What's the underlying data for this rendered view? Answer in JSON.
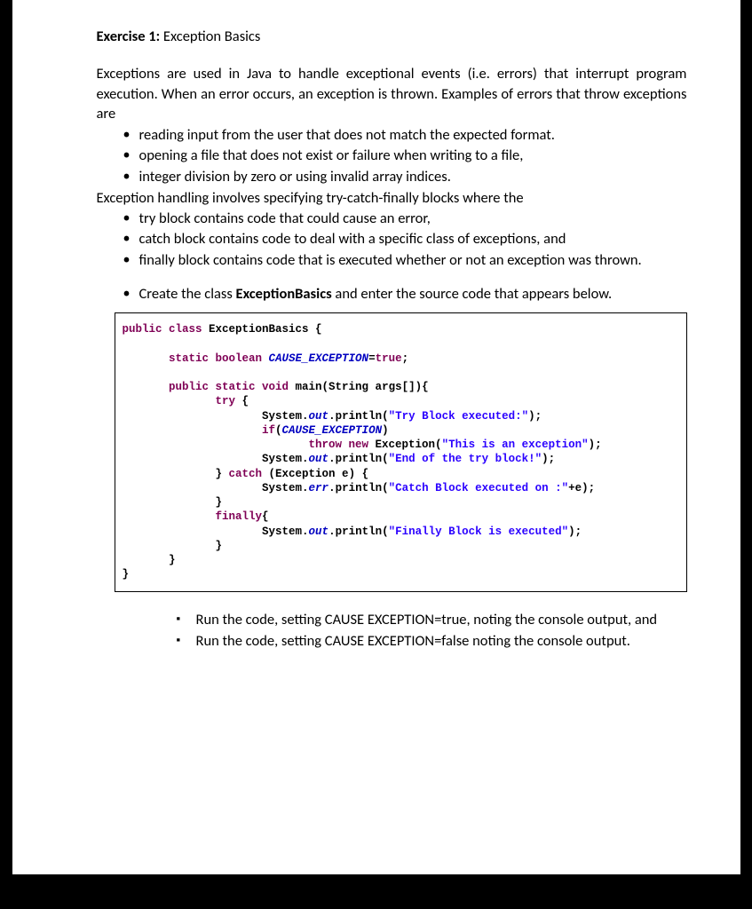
{
  "heading": {
    "label": "Exercise 1:",
    "title": " Exception Basics"
  },
  "intro": "Exceptions are used in Java to handle exceptional events (i.e. errors) that interrupt program execution. When an error occurs, an exception is thrown. Examples of errors that throw exceptions are",
  "examples": [
    "reading input from the user that does not match the expected format.",
    "opening a file that does not exist or failure when writing to a file,",
    "integer division by zero or using invalid array indices."
  ],
  "handling_intro": "Exception handling involves specifying try-catch-finally blocks where the",
  "handling_points": [
    "try block contains code that could cause an error,",
    "catch block contains code to deal with a specific class of exceptions, and",
    "finally block contains code that is executed whether or not an exception was thrown."
  ],
  "task_prefix": "Create the class ",
  "task_classname": "ExceptionBasics",
  "task_suffix": " and enter the source code that appears below.",
  "code": {
    "l1a": "public class ",
    "l1b": "ExceptionBasics {",
    "l2a": "       static boolean ",
    "l2b": "CAUSE_EXCEPTION",
    "l2c": "=",
    "l2d": "true",
    "l2e": ";",
    "l3a": "       public static void ",
    "l3b": "main(String args[]){",
    "l4a": "              try",
    "l4b": " {",
    "l5a": "                     System.",
    "l5b": "out",
    "l5c": ".println(",
    "l5d": "\"Try Block executed:\"",
    "l5e": ");",
    "l6a": "                     if",
    "l6b": "(",
    "l6c": "CAUSE_EXCEPTION",
    "l6d": ")",
    "l7a": "                            throw new ",
    "l7b": "Exception(",
    "l7c": "\"This is an exception\"",
    "l7d": ");",
    "l8a": "                     System.",
    "l8b": "out",
    "l8c": ".println(",
    "l8d": "\"End of the try block!\"",
    "l8e": ");",
    "l9a": "              } ",
    "l9b": "catch",
    "l9c": " (Exception e) {",
    "l10a": "                     System.",
    "l10b": "err",
    "l10c": ".println(",
    "l10d": "\"Catch Block executed on :\"",
    "l10e": "+e);",
    "l11": "              }",
    "l12a": "              finally",
    "l12b": "{",
    "l13a": "                     System.",
    "l13b": "out",
    "l13c": ".println(",
    "l13d": "\"Finally Block is executed\"",
    "l13e": ");",
    "l14": "              }",
    "l15": "       }",
    "l16": "}"
  },
  "run_steps": [
    "Run the code, setting CAUSE EXCEPTION=true, noting the console output, and",
    "Run the code, setting CAUSE EXCEPTION=false noting the console output."
  ]
}
